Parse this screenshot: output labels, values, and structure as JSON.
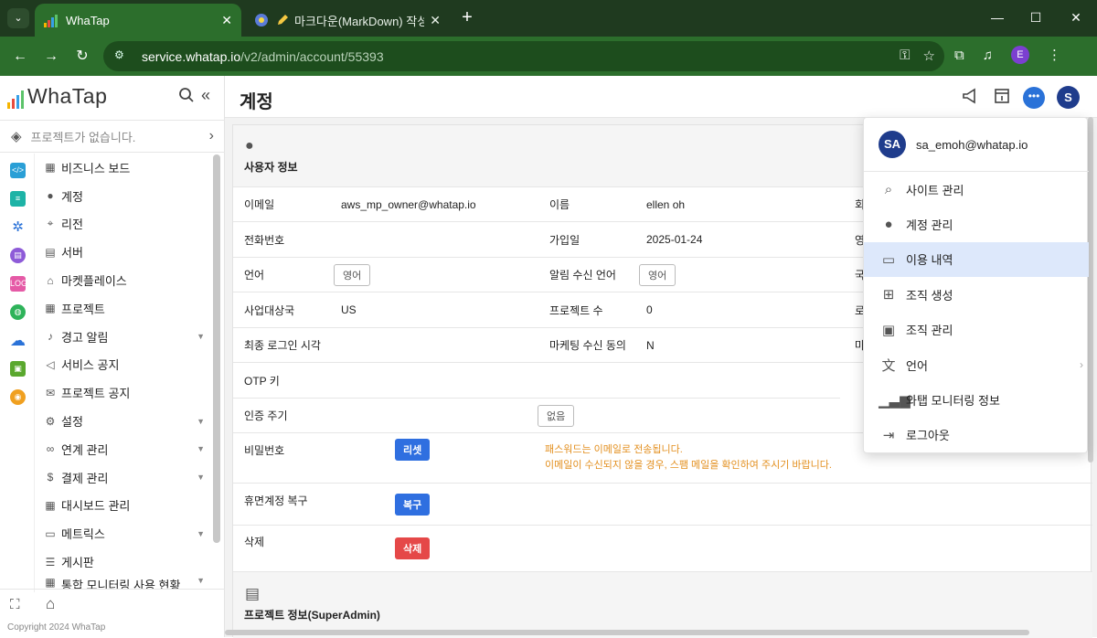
{
  "browser": {
    "tab_switch_icon": "chevron-down-icon",
    "tabs": [
      {
        "title": "WhaTap",
        "active": true,
        "close": "✕"
      },
      {
        "title": "마크다운(MarkDown) 작성",
        "active": false,
        "close": "✕"
      }
    ],
    "new_tab": "+",
    "window_controls": {
      "minimize": "—",
      "maximize": "☐",
      "close": "✕"
    },
    "url_host": "service.whatap.io",
    "url_path": "/v2/admin/account/55393",
    "profile_initial": "E"
  },
  "sidebar": {
    "logo_text": "WhaTap",
    "project_placeholder": "프로젝트가 없습니다.",
    "items": [
      {
        "label": "비즈니스 보드",
        "icon": "grid-icon",
        "caret": false
      },
      {
        "label": "계정",
        "icon": "person-icon",
        "caret": false
      },
      {
        "label": "리전",
        "icon": "location-icon",
        "caret": false
      },
      {
        "label": "서버",
        "icon": "database-icon",
        "caret": false
      },
      {
        "label": "마켓플레이스",
        "icon": "store-icon",
        "caret": false
      },
      {
        "label": "프로젝트",
        "icon": "grid-icon",
        "caret": false
      },
      {
        "label": "경고 알림",
        "icon": "bell-icon",
        "caret": true
      },
      {
        "label": "서비스 공지",
        "icon": "megaphone-icon",
        "caret": false
      },
      {
        "label": "프로젝트 공지",
        "icon": "mail-icon",
        "caret": false
      },
      {
        "label": "설정",
        "icon": "gear-icon",
        "caret": true
      },
      {
        "label": "연계 관리",
        "icon": "link-icon",
        "caret": true
      },
      {
        "label": "결제 관리",
        "icon": "dollar-icon",
        "caret": true
      },
      {
        "label": "대시보드 관리",
        "icon": "grid-icon",
        "caret": false
      },
      {
        "label": "메트릭스",
        "icon": "document-icon",
        "caret": true
      },
      {
        "label": "게시판",
        "icon": "list-icon",
        "caret": false
      },
      {
        "label": "통합 모니터링 사용 현황",
        "icon": "grid-icon",
        "caret": true
      }
    ],
    "copyright": "Copyright 2024 WhaTap"
  },
  "page": {
    "title": "계정",
    "user_section_label": "사용자 정보",
    "fields": {
      "email_label": "이메일",
      "email_value": "aws_mp_owner@whatap.io",
      "name_label": "이름",
      "name_value": "ellen oh",
      "col3_row1": "회",
      "phone_label": "전화번호",
      "joined_label": "가입일",
      "joined_value": "2025-01-24",
      "col3_row2": "영",
      "language_label": "언어",
      "language_value": "영어",
      "notify_lang_label": "알림 수신 언어",
      "notify_lang_value": "영어",
      "col3_row3": "국",
      "country_label": "사업대상국",
      "country_value": "US",
      "project_count_label": "프로젝트 수",
      "project_count_value": "0",
      "col3_row4": "로",
      "last_login_label": "최종 로그인 시각",
      "marketing_label": "마케팅 수신 동의",
      "marketing_value": "N",
      "col3_row5": "마",
      "otp_label": "OTP 키",
      "auth_cycle_label": "인증 주기",
      "auth_cycle_value": "없음",
      "password_label": "비밀번호",
      "reset_button": "리셋",
      "password_note_1": "패스워드는 이메일로 전송됩니다.",
      "password_note_2": "이메일이 수신되지 않을 경우, 스팸 메일을 확인하여 주시기 바랍니다.",
      "dormant_label": "휴면계정 복구",
      "restore_button": "복구",
      "delete_label": "삭제",
      "delete_button": "삭제"
    },
    "project_section_label": "프로젝트 정보(SuperAdmin)"
  },
  "topbar": {
    "avatar_initial": "S",
    "chat_glyph": "•••"
  },
  "user_menu": {
    "avatar": "SA",
    "email": "sa_emoh@whatap.io",
    "items": [
      {
        "label": "사이트 관리",
        "icon": "site-search-icon"
      },
      {
        "label": "계정 관리",
        "icon": "person-icon"
      },
      {
        "label": "이용 내역",
        "icon": "credit-card-icon",
        "highlight": true
      },
      {
        "label": "조직 생성",
        "icon": "folder-add-icon"
      },
      {
        "label": "조직 관리",
        "icon": "folder-person-icon"
      },
      {
        "label": "언어",
        "icon": "translate-icon",
        "has_submenu": true
      },
      {
        "label": "와탭 모니터링 정보",
        "icon": "bars-icon"
      },
      {
        "label": "로그아웃",
        "icon": "logout-icon"
      }
    ]
  },
  "colors": {
    "chrome_dark": "#1f3a1f",
    "chrome_tab": "#2c6e2c",
    "accent_blue": "#2f6fe0",
    "danger_red": "#e54848",
    "warning_orange": "#e39020",
    "avatar_navy": "#1f3c8c",
    "menu_highlight": "#dde8fb"
  }
}
